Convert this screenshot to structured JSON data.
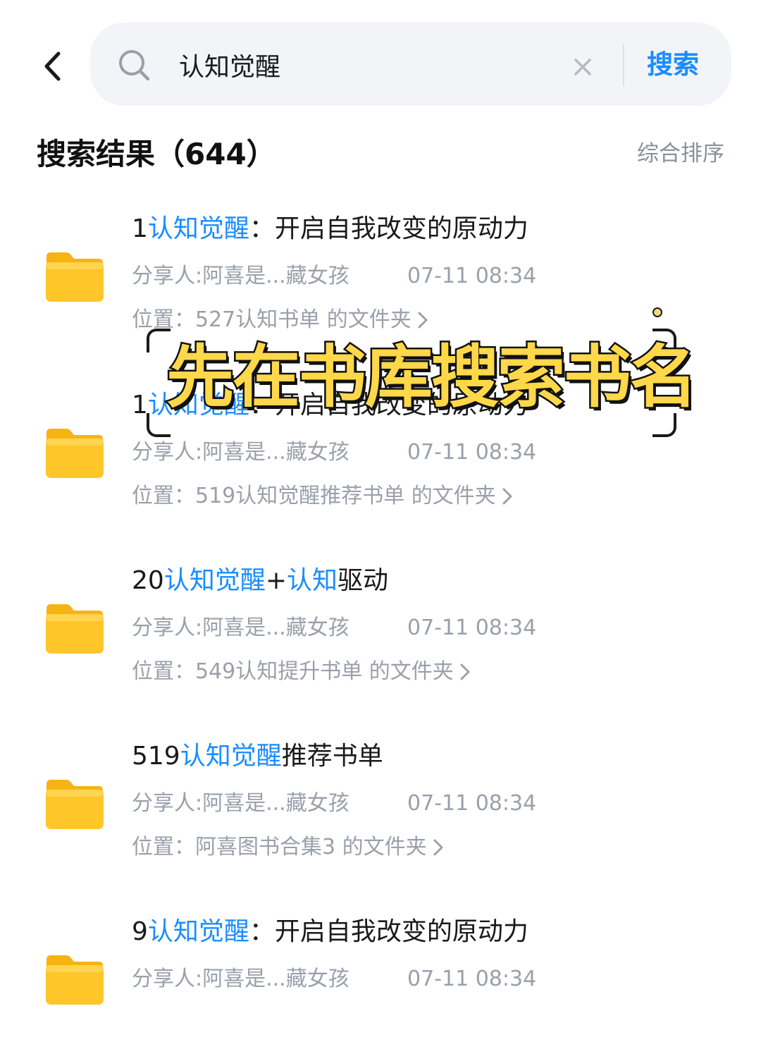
{
  "header": {
    "back_icon": "chevron-left-icon",
    "search": {
      "icon": "search-icon",
      "value": "认知觉醒",
      "clear_icon": "close-icon",
      "submit_label": "搜索"
    }
  },
  "results": {
    "heading": "搜索结果（644）",
    "sort_label": "综合排序",
    "items": [
      {
        "title_parts": [
          {
            "text": "1",
            "highlight": false
          },
          {
            "text": "认知觉醒",
            "highlight": true
          },
          {
            "text": "：开启自我改变的原动力",
            "highlight": false
          }
        ],
        "sharer": "分享人:阿喜是...藏女孩",
        "time": "07-11 08:34",
        "location": "位置：527认知书单 的文件夹"
      },
      {
        "title_parts": [
          {
            "text": "1",
            "highlight": false
          },
          {
            "text": "认知觉醒",
            "highlight": true
          },
          {
            "text": "：开启自我改变的原动力",
            "highlight": false
          }
        ],
        "sharer": "分享人:阿喜是...藏女孩",
        "time": "07-11 08:34",
        "location": "位置：519认知觉醒推荐书单 的文件夹"
      },
      {
        "title_parts": [
          {
            "text": "20",
            "highlight": false
          },
          {
            "text": "认知觉醒",
            "highlight": true
          },
          {
            "text": "+",
            "highlight": false
          },
          {
            "text": "认知",
            "highlight": true
          },
          {
            "text": "驱动",
            "highlight": false
          }
        ],
        "sharer": "分享人:阿喜是...藏女孩",
        "time": "07-11 08:34",
        "location": "位置：549认知提升书单 的文件夹"
      },
      {
        "title_parts": [
          {
            "text": "519",
            "highlight": false
          },
          {
            "text": "认知觉醒",
            "highlight": true
          },
          {
            "text": "推荐书单",
            "highlight": false
          }
        ],
        "sharer": "分享人:阿喜是...藏女孩",
        "time": "07-11 08:34",
        "location": "位置：阿喜图书合集3 的文件夹"
      },
      {
        "title_parts": [
          {
            "text": "9",
            "highlight": false
          },
          {
            "text": "认知觉醒",
            "highlight": true
          },
          {
            "text": "：开启自我改变的原动力",
            "highlight": false
          }
        ],
        "sharer": "分享人:阿喜是...藏女孩",
        "time": "07-11 08:34",
        "location": ""
      }
    ]
  },
  "overlay": {
    "caption": "先在书库搜索书名"
  },
  "colors": {
    "accent": "#1a8cff",
    "folder": "#ffc62a",
    "caption_fill": "#ffd84a",
    "muted_text": "#9aa0aa"
  }
}
